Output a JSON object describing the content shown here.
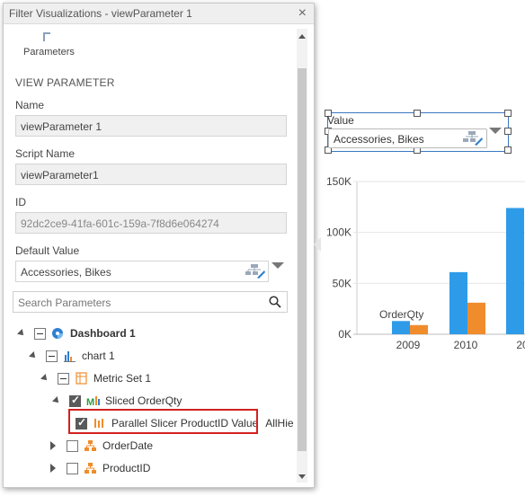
{
  "panel": {
    "title": "Filter Visualizations - viewParameter 1",
    "close_symbol": "×",
    "toolbar_button": "Parameters"
  },
  "view_parameter": {
    "section_title": "VIEW PARAMETER",
    "name_label": "Name",
    "name_value": "viewParameter 1",
    "script_name_label": "Script Name",
    "script_name_value": "viewParameter1",
    "id_label": "ID",
    "id_value": "92dc2ce9-41fa-601c-159a-7f8d6e064274",
    "default_value_label": "Default Value",
    "default_value": "Accessories, Bikes"
  },
  "search": {
    "placeholder": "Search Parameters"
  },
  "tree": {
    "dashboard": "Dashboard 1",
    "chart": "chart 1",
    "metric_set": "Metric Set 1",
    "sliced": "Sliced OrderQty",
    "parallel_slicer": "Parallel Slicer ProductID Value",
    "parallel_slicer_extra": "AllHie",
    "order_date": "OrderDate",
    "product_id": "ProductID"
  },
  "value_widget": {
    "label": "Value",
    "value": "Accessories, Bikes"
  },
  "colors": {
    "series_1": "#2e9be8",
    "series_2": "#f08c2c",
    "highlight": "#d42020",
    "selection": "#3a78c0"
  },
  "chart_data": {
    "type": "bar",
    "categories": [
      "2009",
      "2010",
      "20"
    ],
    "series": [
      {
        "name": "",
        "values": [
          13000,
          61000,
          124000
        ]
      },
      {
        "name": "",
        "values": [
          9000,
          31000,
          null
        ]
      }
    ],
    "y_ticks": [
      "0K",
      "50K",
      "100K",
      "150K"
    ],
    "ylim": [
      0,
      150000
    ],
    "annotation": "OrderQty"
  }
}
